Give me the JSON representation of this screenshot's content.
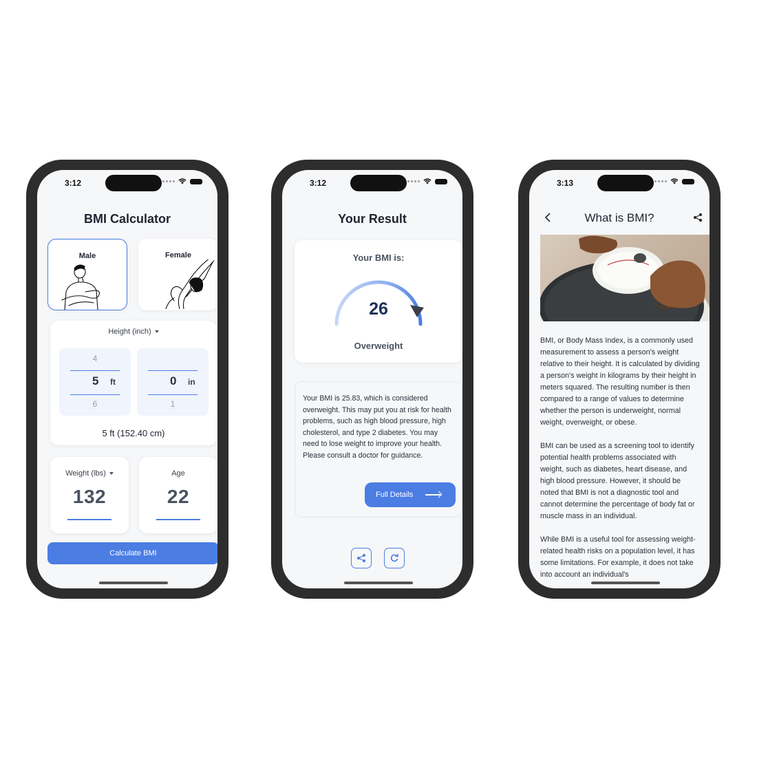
{
  "status": {
    "phone1_time": "3:12",
    "phone2_time": "3:12",
    "phone3_time": "3:13"
  },
  "calculator": {
    "title": "BMI Calculator",
    "gender_male": "Male",
    "gender_female": "Female",
    "height_label": "Height (inch)",
    "ft_prev": "4",
    "ft_value": "5",
    "ft_next": "6",
    "ft_unit": "ft",
    "in_value": "0",
    "in_next": "1",
    "in_unit": "in",
    "height_summary": "5 ft (152.40 cm)",
    "weight_label": "Weight (lbs)",
    "weight_value": "132",
    "age_label": "Age",
    "age_value": "22",
    "calculate_button": "Calculate BMI"
  },
  "result": {
    "title": "Your Result",
    "bmi_caption": "Your BMI is:",
    "bmi_value": "26",
    "category": "Overweight",
    "description": "Your BMI is 25.83, which is considered overweight. This may put you at risk for health problems, such as high blood pressure, high cholesterol, and type 2 diabetes. You may need to lose weight to improve your health. Please consult a doctor for guidance.",
    "full_details_button": "Full Details"
  },
  "article": {
    "title": "What is BMI?",
    "paragraph1": "BMI, or Body Mass Index, is a commonly used measurement to assess a person's weight relative to their height. It is calculated by dividing a person's weight in kilograms by their height in meters squared. The resulting number is then compared to a range of values to determine whether the person is underweight, normal weight, overweight, or obese.",
    "paragraph2": "BMI can be used as a screening tool to identify potential health problems associated with weight, such as diabetes, heart disease, and high blood pressure. However, it should be noted that BMI is not a diagnostic tool and cannot determine the percentage of body fat or muscle mass in an individual.",
    "paragraph3": "While BMI is a useful tool for assessing weight-related health risks on a population level, it has some limitations. For example, it does not take into account an individual's"
  },
  "colors": {
    "accent": "#4b7de3",
    "frame": "#2d2d2d",
    "screen_bg": "#f6f7f9"
  }
}
